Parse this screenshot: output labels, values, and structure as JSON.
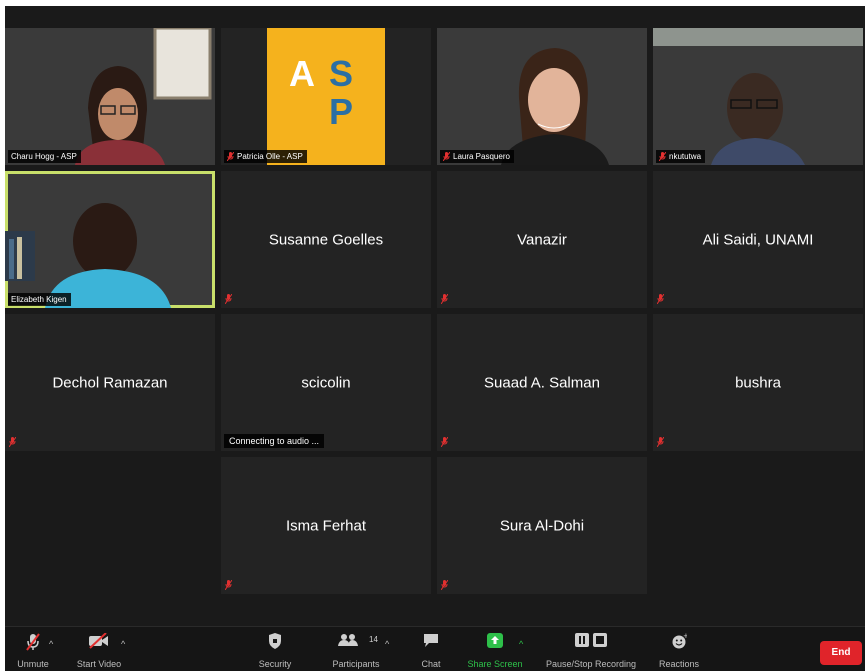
{
  "participants": [
    {
      "name": "Charu Hogg - ASP",
      "video": true
    },
    {
      "name": "Patricia Olle - ASP",
      "video": true,
      "logo_text": [
        "A",
        "S",
        "P"
      ]
    },
    {
      "name": "Laura Pasquero",
      "video": true
    },
    {
      "name": "nkututwa",
      "video": true
    },
    {
      "name": "Elizabeth Kigen",
      "video": true,
      "active_speaker": true
    },
    {
      "name": "Susanne Goelles",
      "video": false
    },
    {
      "name": "Vanazir",
      "video": false
    },
    {
      "name": "Ali Saidi, UNAMI",
      "video": false
    },
    {
      "name": "Dechol Ramazan",
      "video": false
    },
    {
      "name": "scicolin",
      "video": false,
      "status": "Connecting to audio ..."
    },
    {
      "name": "Suaad A. Salman",
      "video": false
    },
    {
      "name": "bushra",
      "video": false
    },
    {
      "name": "Isma Ferhat",
      "video": false
    },
    {
      "name": "Sura Al-Dohi",
      "video": false
    }
  ],
  "toolbar": {
    "unmute": "Unmute",
    "start_video": "Start Video",
    "security": "Security",
    "participants": "Participants",
    "participants_count": "14",
    "chat": "Chat",
    "share_screen": "Share Screen",
    "pause_stop_recording": "Pause/Stop Recording",
    "reactions": "Reactions",
    "end": "End"
  },
  "colors": {
    "active_speaker_border": "#c8df6a",
    "share_screen_green": "#2ec04a",
    "end_red": "#e0242a",
    "muted_red": "#e23030",
    "asp_yellow": "#f5b21d",
    "asp_blue": "#2c6fa3"
  },
  "icons": [
    "muted-mic-icon",
    "mic-icon",
    "video-off-icon",
    "shield-icon",
    "participants-icon",
    "chat-icon",
    "share-screen-icon",
    "pause-icon",
    "stop-icon",
    "reactions-icon",
    "chevron-up-icon"
  ]
}
